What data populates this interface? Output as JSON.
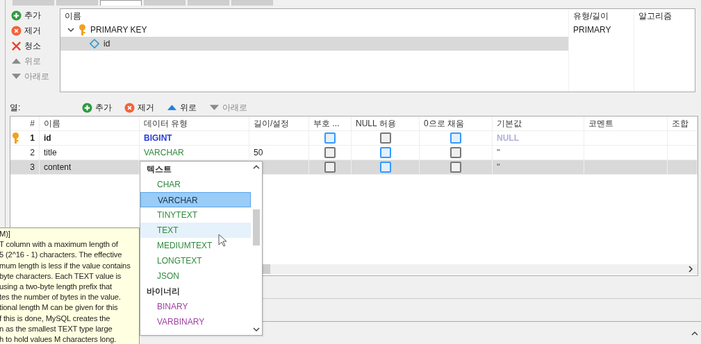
{
  "tabs": [
    {
      "selected": false
    },
    {
      "selected": false
    },
    {
      "selected": true
    },
    {
      "selected": false
    },
    {
      "selected": false
    },
    {
      "selected": false
    }
  ],
  "index_toolbar": [
    {
      "kind": "add",
      "label": "추가",
      "disabled": false
    },
    {
      "kind": "remove",
      "label": "제거",
      "disabled": false
    },
    {
      "kind": "clear",
      "label": "청소",
      "disabled": false
    },
    {
      "kind": "up",
      "label": "위로",
      "disabled": true
    },
    {
      "kind": "down",
      "label": "아래로",
      "disabled": true
    }
  ],
  "index_tree": {
    "columns": [
      "이름",
      "유형/길이",
      "알고리즘"
    ],
    "nodes": [
      {
        "name": "PRIMARY KEY",
        "type": "PRIMARY",
        "expanded": true,
        "selected": false,
        "children": [
          {
            "name": "id",
            "selected": true
          }
        ]
      }
    ]
  },
  "columns_label": "열:",
  "column_toolbar": [
    {
      "kind": "add",
      "label": "추가",
      "disabled": false
    },
    {
      "kind": "remove",
      "label": "제거",
      "disabled": false
    },
    {
      "kind": "up",
      "label": "위로",
      "disabled": false
    },
    {
      "kind": "down",
      "label": "아래로",
      "disabled": true
    }
  ],
  "table": {
    "columns": [
      "#",
      "이름",
      "데이터 유형",
      "길이/설정",
      "부호 ...",
      "NULL 허용",
      "0으로 채움",
      "기본값",
      "코멘트",
      "조합"
    ],
    "rows": [
      {
        "primary": true,
        "number": "1",
        "name": "id",
        "type": {
          "label": "BIGINT",
          "color": "#2a3fd6"
        },
        "length": "",
        "unsigned": true,
        "nullable": false,
        "zerofill": true,
        "default": "NULL",
        "default_is_null": true,
        "selected": false
      },
      {
        "primary": false,
        "number": "2",
        "name": "title",
        "type": {
          "label": "VARCHAR",
          "color": "#2e8b3a"
        },
        "length": "50",
        "unsigned": false,
        "nullable": true,
        "zerofill": false,
        "default": "''",
        "default_is_null": false,
        "selected": false
      },
      {
        "primary": false,
        "number": "3",
        "name": "content",
        "length": "",
        "unsigned": false,
        "nullable": true,
        "zerofill": false,
        "default": "''",
        "default_is_null": false,
        "selected": true
      }
    ]
  },
  "type_dropdown": [
    {
      "group": "텍스트",
      "color": "#2e8b3a",
      "items": [
        {
          "label": "CHAR",
          "selected": false,
          "hovered": false
        },
        {
          "label": "VARCHAR",
          "selected": true,
          "hovered": false
        },
        {
          "label": "TINYTEXT",
          "selected": false,
          "hovered": false
        },
        {
          "label": "TEXT",
          "selected": false,
          "hovered": true
        },
        {
          "label": "MEDIUMTEXT",
          "selected": false,
          "hovered": false
        },
        {
          "label": "LONGTEXT",
          "selected": false,
          "hovered": false
        },
        {
          "label": "JSON",
          "selected": false,
          "hovered": false
        }
      ]
    },
    {
      "group": "바이너리",
      "color": "#a040a0",
      "items": [
        {
          "label": "BINARY",
          "selected": false,
          "hovered": false
        },
        {
          "label": "VARBINARY",
          "selected": false,
          "hovered": false
        }
      ]
    }
  ],
  "tooltip": [
    "M)]",
    "T column with a maximum length of",
    "5 (2^16 - 1) characters. The effective",
    "mum length is less if the value contains",
    "byte characters. Each TEXT value is",
    "using a two-byte length prefix that",
    "tes the number of bytes in the value.",
    "tional length M can be given for this",
    "f this is done, MySQL creates the",
    "n as the smallest TEXT type large",
    "h to hold values M characters long."
  ]
}
